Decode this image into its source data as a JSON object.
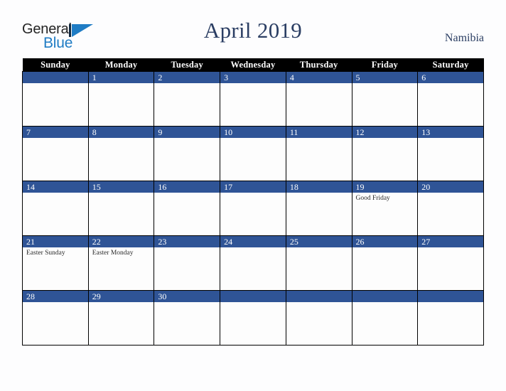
{
  "branding": {
    "name_part1": "General",
    "name_part2": "Blue",
    "mark": "triangle-flag-mark",
    "colors": {
      "general_text": "#242424",
      "blue_text": "#1f7cc4",
      "mark_blue": "#1f7cc4",
      "mark_bar": "#13293f"
    }
  },
  "header": {
    "title": "April 2019",
    "region": "Namibia",
    "title_color": "#2b3e63"
  },
  "calendar": {
    "month": "April",
    "year": "2019",
    "header_background": "#000000",
    "header_text_color": "#ffffff",
    "daynum_background": "#2f5496",
    "daynum_text_color": "#ffffff",
    "cell_background": "#fdfdfd",
    "border_color": "#000000",
    "weekday_headers": [
      "Sunday",
      "Monday",
      "Tuesday",
      "Wednesday",
      "Thursday",
      "Friday",
      "Saturday"
    ],
    "weeks": [
      [
        {
          "day": "",
          "events": []
        },
        {
          "day": "1",
          "events": []
        },
        {
          "day": "2",
          "events": []
        },
        {
          "day": "3",
          "events": []
        },
        {
          "day": "4",
          "events": []
        },
        {
          "day": "5",
          "events": []
        },
        {
          "day": "6",
          "events": []
        }
      ],
      [
        {
          "day": "7",
          "events": []
        },
        {
          "day": "8",
          "events": []
        },
        {
          "day": "9",
          "events": []
        },
        {
          "day": "10",
          "events": []
        },
        {
          "day": "11",
          "events": []
        },
        {
          "day": "12",
          "events": []
        },
        {
          "day": "13",
          "events": []
        }
      ],
      [
        {
          "day": "14",
          "events": []
        },
        {
          "day": "15",
          "events": []
        },
        {
          "day": "16",
          "events": []
        },
        {
          "day": "17",
          "events": []
        },
        {
          "day": "18",
          "events": []
        },
        {
          "day": "19",
          "events": [
            "Good Friday"
          ]
        },
        {
          "day": "20",
          "events": []
        }
      ],
      [
        {
          "day": "21",
          "events": [
            "Easter Sunday"
          ]
        },
        {
          "day": "22",
          "events": [
            "Easter Monday"
          ]
        },
        {
          "day": "23",
          "events": []
        },
        {
          "day": "24",
          "events": []
        },
        {
          "day": "25",
          "events": []
        },
        {
          "day": "26",
          "events": []
        },
        {
          "day": "27",
          "events": []
        }
      ],
      [
        {
          "day": "28",
          "events": []
        },
        {
          "day": "29",
          "events": []
        },
        {
          "day": "30",
          "events": []
        },
        {
          "day": "",
          "events": []
        },
        {
          "day": "",
          "events": []
        },
        {
          "day": "",
          "events": []
        },
        {
          "day": "",
          "events": []
        }
      ]
    ]
  }
}
